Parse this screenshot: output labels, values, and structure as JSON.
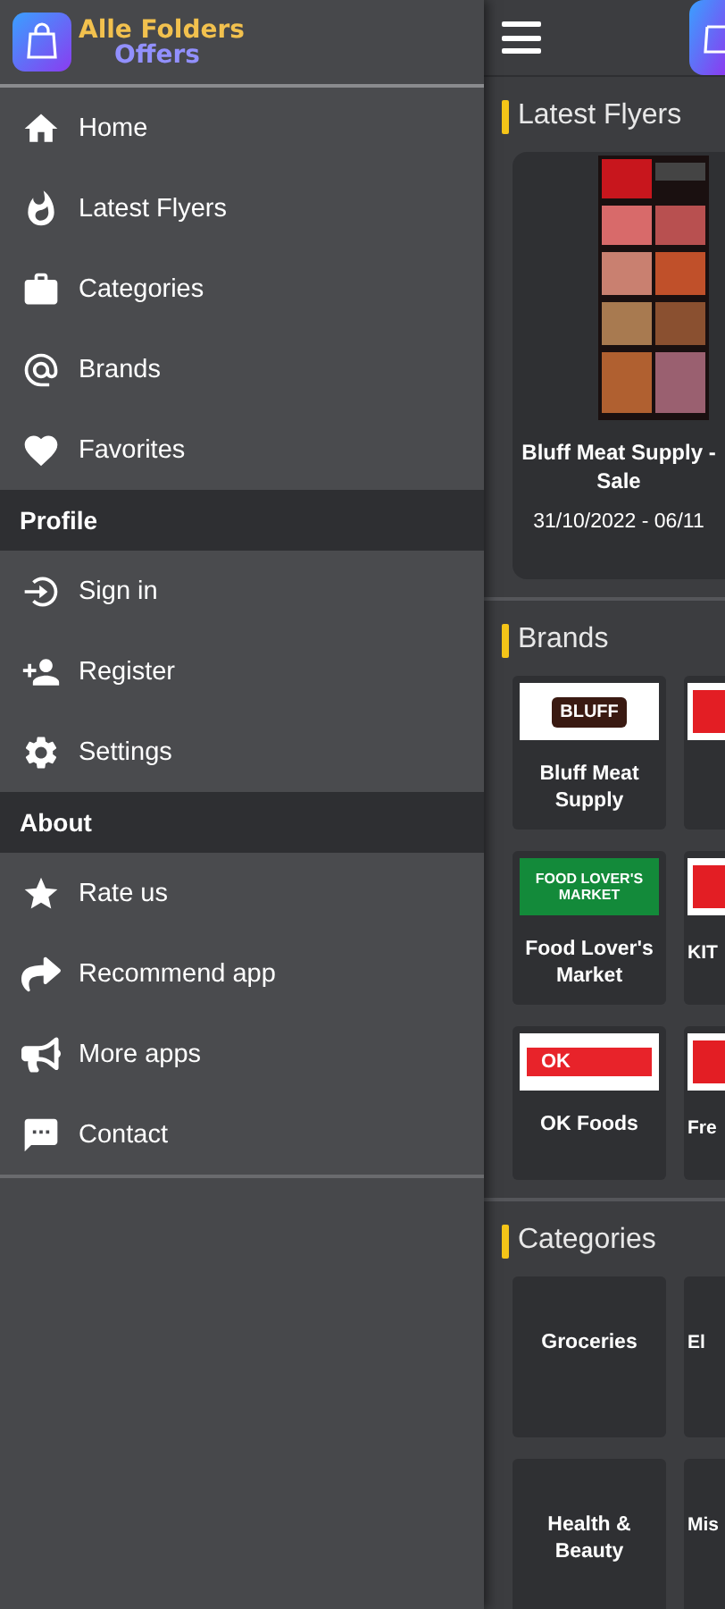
{
  "drawer": {
    "app_name": "Alle Folders",
    "app_subtitle": "Offers",
    "sections": [
      {
        "items": [
          {
            "label": "Home"
          },
          {
            "label": "Latest Flyers"
          },
          {
            "label": "Categories"
          },
          {
            "label": "Brands"
          },
          {
            "label": "Favorites"
          }
        ]
      },
      {
        "title": "Profile",
        "items": [
          {
            "label": "Sign in"
          },
          {
            "label": "Register"
          },
          {
            "label": "Settings"
          }
        ]
      },
      {
        "title": "About",
        "items": [
          {
            "label": "Rate us"
          },
          {
            "label": "Recommend app"
          },
          {
            "label": "More apps"
          },
          {
            "label": "Contact"
          }
        ]
      }
    ]
  },
  "main": {
    "flyers": {
      "title": "Latest Flyers",
      "items": [
        {
          "title_lines": [
            "Bluff Meat Supply -",
            "Sale"
          ],
          "dates": "31/10/2022 - 06/11"
        }
      ]
    },
    "brands": {
      "title": "Brands",
      "rows": [
        [
          {
            "kind": "bluff",
            "logo_text": "BLUFF",
            "name": "Bluff Meat Supply"
          },
          {
            "kind": "red"
          }
        ],
        [
          {
            "kind": "green",
            "logo_text": "FOOD LOVER'S MARKET",
            "name": "Food Lover's Market"
          },
          {
            "kind": "red",
            "name": "KIT"
          }
        ],
        [
          {
            "kind": "ok",
            "logo_text": "OK",
            "name": "OK Foods"
          },
          {
            "kind": "red",
            "name": "Fre"
          }
        ]
      ]
    },
    "categories": {
      "title": "Categories",
      "rows": [
        [
          {
            "name": "Groceries"
          },
          {
            "name": "El"
          }
        ],
        [
          {
            "name": "Health & Beauty"
          },
          {
            "name": "Mis"
          }
        ]
      ]
    }
  }
}
